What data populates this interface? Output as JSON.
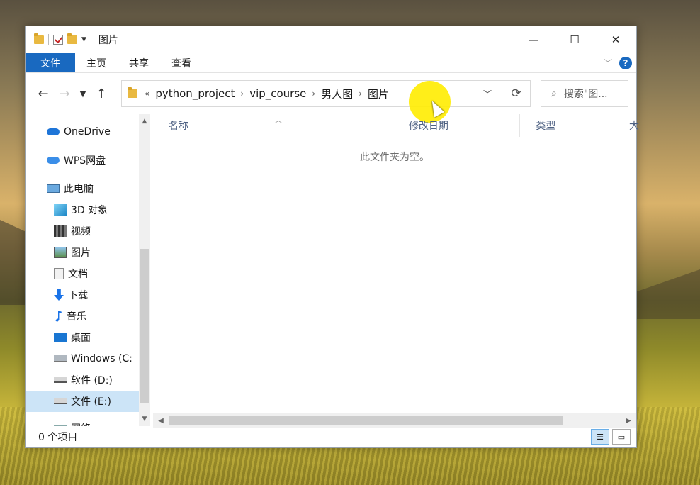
{
  "window": {
    "title": "图片",
    "controls": {
      "minimize": "—",
      "maximize": "☐",
      "close": "✕"
    }
  },
  "ribbon": {
    "file_tab": "文件",
    "tabs": [
      "主页",
      "共享",
      "查看"
    ],
    "help": "?"
  },
  "address": {
    "overflow": "«",
    "crumbs": [
      "python_project",
      "vip_course",
      "男人图",
      "图片"
    ],
    "search_placeholder": "搜索\"图..."
  },
  "nav": {
    "items": [
      {
        "label": "OneDrive",
        "icon": "onedrive-cloud-icon"
      },
      {
        "label": "WPS网盘",
        "icon": "wps-cloud-icon"
      },
      {
        "label": "此电脑",
        "icon": "this-pc-icon"
      },
      {
        "label": "3D 对象",
        "icon": "3d-objects-icon"
      },
      {
        "label": "视频",
        "icon": "video-icon"
      },
      {
        "label": "图片",
        "icon": "pictures-icon"
      },
      {
        "label": "文档",
        "icon": "documents-icon"
      },
      {
        "label": "下载",
        "icon": "downloads-icon"
      },
      {
        "label": "音乐",
        "icon": "music-icon"
      },
      {
        "label": "桌面",
        "icon": "desktop-icon"
      },
      {
        "label": "Windows (C:",
        "icon": "windows-drive-icon"
      },
      {
        "label": "软件 (D:)",
        "icon": "drive-icon"
      },
      {
        "label": "文件 (E:)",
        "icon": "drive-icon"
      },
      {
        "label": "网络",
        "icon": "network-icon"
      }
    ]
  },
  "content": {
    "columns": [
      "名称",
      "修改日期",
      "类型",
      "大"
    ],
    "empty_message": "此文件夹为空。"
  },
  "status": {
    "item_count": "0 个项目"
  }
}
